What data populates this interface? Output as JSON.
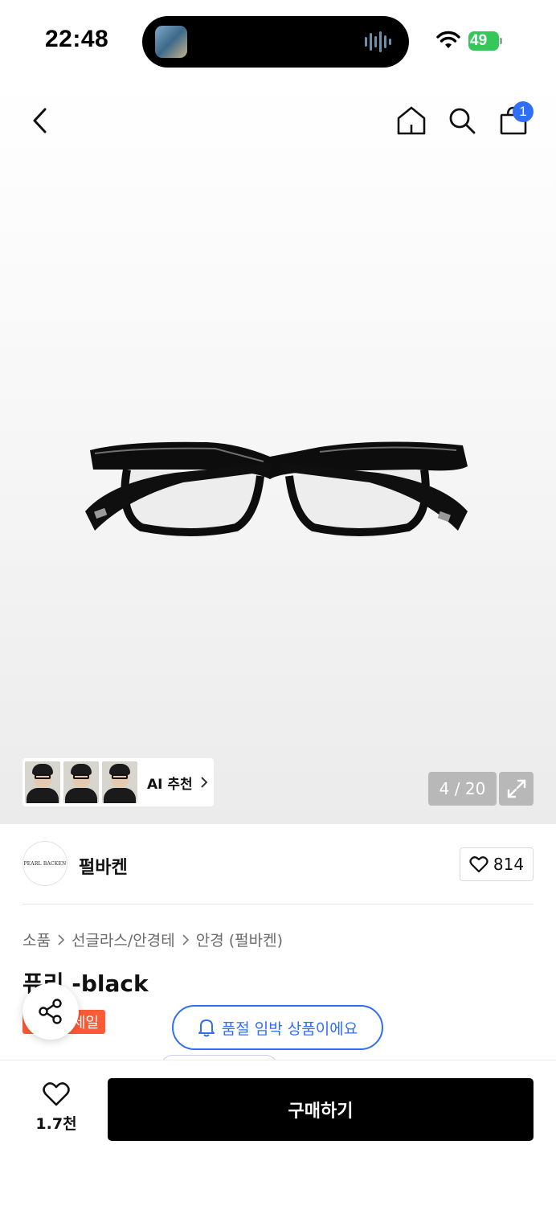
{
  "status_bar": {
    "time": "22:48",
    "battery": "49"
  },
  "nav": {
    "cart_badge": "1",
    "icons": [
      "back-arrow-icon",
      "home-icon",
      "search-icon",
      "shopping-bag-icon"
    ]
  },
  "gallery": {
    "ai_label": "AI 추천",
    "pager": "4 / 20"
  },
  "brand": {
    "logo_text": "PEARL BACKEN",
    "name": "펄바켄",
    "likes": "814"
  },
  "breadcrumb": [
    "소품",
    "선글라스/안경테",
    "안경 (펄바켄)"
  ],
  "product": {
    "title": "퓨리 -black",
    "sale_badge": "세일"
  },
  "notice": {
    "soldout": "품절 임박 상품이에요"
  },
  "bottom": {
    "wish_count": "1.7천",
    "buy_label": "구매하기"
  },
  "colors": {
    "accent_blue": "#2f6ff4",
    "sale_red": "#ff5a36",
    "buy_black": "#000000"
  }
}
